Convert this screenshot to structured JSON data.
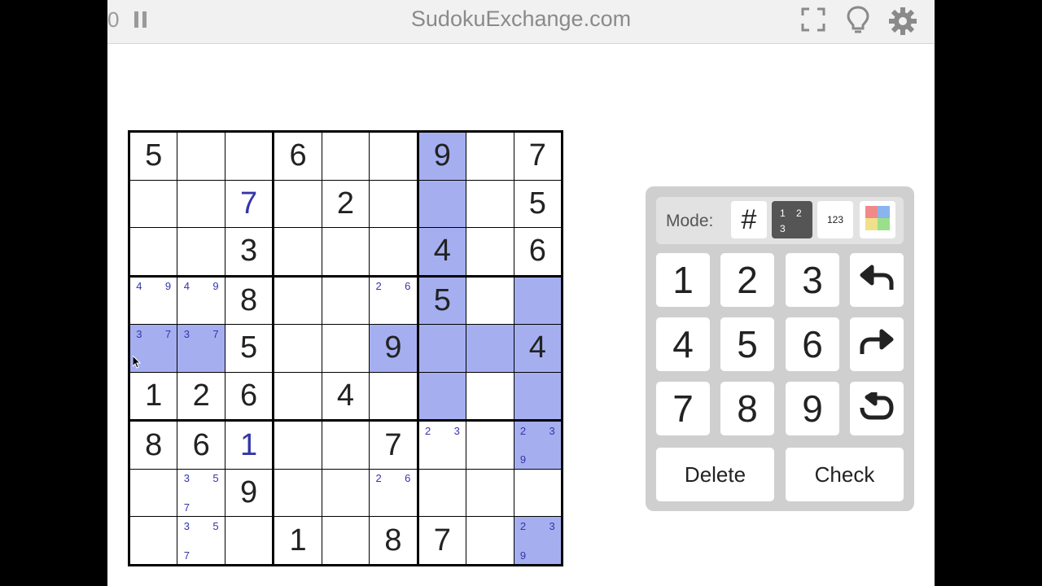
{
  "header": {
    "timer": "0",
    "title": "SudokuExchange.com"
  },
  "board": {
    "givens": [
      [
        "5",
        "",
        "",
        "6",
        "",
        "",
        "9",
        "",
        "7"
      ],
      [
        "",
        "",
        "",
        "",
        "2",
        "",
        "",
        "",
        "5"
      ],
      [
        "",
        "",
        "3",
        "",
        "",
        "",
        "4",
        "",
        "6"
      ],
      [
        "",
        "",
        "8",
        "",
        "",
        "",
        "5",
        "",
        ""
      ],
      [
        "",
        "",
        "5",
        "",
        "",
        "9",
        "",
        "",
        "4"
      ],
      [
        "1",
        "2",
        "6",
        "",
        "4",
        "",
        "",
        "",
        ""
      ],
      [
        "8",
        "6",
        "",
        "",
        "",
        "7",
        "",
        "",
        ""
      ],
      [
        "",
        "",
        "9",
        "",
        "",
        "",
        "",
        "",
        ""
      ],
      [
        "",
        "",
        "",
        "1",
        "",
        "8",
        "7",
        "",
        ""
      ]
    ],
    "user_entries": [
      {
        "r": 1,
        "c": 2,
        "v": "7"
      },
      {
        "r": 6,
        "c": 2,
        "v": "1"
      }
    ],
    "notes": [
      {
        "r": 3,
        "c": 0,
        "v": [
          "4",
          "",
          "9",
          "",
          "",
          "",
          "",
          "",
          ""
        ]
      },
      {
        "r": 3,
        "c": 1,
        "v": [
          "4",
          "",
          "9",
          "",
          "",
          "",
          "",
          "",
          ""
        ]
      },
      {
        "r": 3,
        "c": 5,
        "v": [
          "2",
          "",
          "6",
          "",
          "",
          "",
          "",
          "",
          ""
        ]
      },
      {
        "r": 4,
        "c": 0,
        "v": [
          "3",
          "",
          "7",
          "",
          "",
          "",
          "",
          "",
          ""
        ]
      },
      {
        "r": 4,
        "c": 1,
        "v": [
          "3",
          "",
          "7",
          "",
          "",
          "",
          "",
          "",
          ""
        ]
      },
      {
        "r": 6,
        "c": 6,
        "v": [
          "2",
          "",
          "3",
          "",
          "",
          "",
          "",
          "",
          ""
        ]
      },
      {
        "r": 6,
        "c": 8,
        "v": [
          "2",
          "",
          "3",
          "",
          "",
          "",
          "9",
          "",
          ""
        ]
      },
      {
        "r": 7,
        "c": 1,
        "v": [
          "3",
          "",
          "5",
          "",
          "",
          "",
          "7",
          "",
          ""
        ]
      },
      {
        "r": 7,
        "c": 5,
        "v": [
          "2",
          "",
          "6",
          "",
          "",
          "",
          "",
          "",
          ""
        ]
      },
      {
        "r": 8,
        "c": 1,
        "v": [
          "3",
          "",
          "5",
          "",
          "",
          "",
          "7",
          "",
          ""
        ]
      },
      {
        "r": 8,
        "c": 8,
        "v": [
          "2",
          "",
          "3",
          "",
          "",
          "",
          "9",
          "",
          ""
        ]
      }
    ],
    "highlighted": [
      [
        0,
        6
      ],
      [
        1,
        6
      ],
      [
        2,
        6
      ],
      [
        3,
        6
      ],
      [
        4,
        6
      ],
      [
        5,
        6
      ],
      [
        3,
        8
      ],
      [
        4,
        8
      ],
      [
        5,
        8
      ],
      [
        6,
        8
      ],
      [
        8,
        8
      ],
      [
        4,
        0
      ],
      [
        4,
        1
      ],
      [
        4,
        5
      ],
      [
        4,
        7
      ]
    ],
    "highlight_color": "#a5aff0",
    "user_color": "#3535a8"
  },
  "pad": {
    "mode_label": "Mode:",
    "mode_normal": "#",
    "mode_candidate": [
      "1",
      "2",
      "3"
    ],
    "mode_center": "123",
    "digits": [
      "1",
      "2",
      "3",
      "4",
      "5",
      "6",
      "7",
      "8",
      "9"
    ],
    "delete_label": "Delete",
    "check_label": "Check"
  }
}
